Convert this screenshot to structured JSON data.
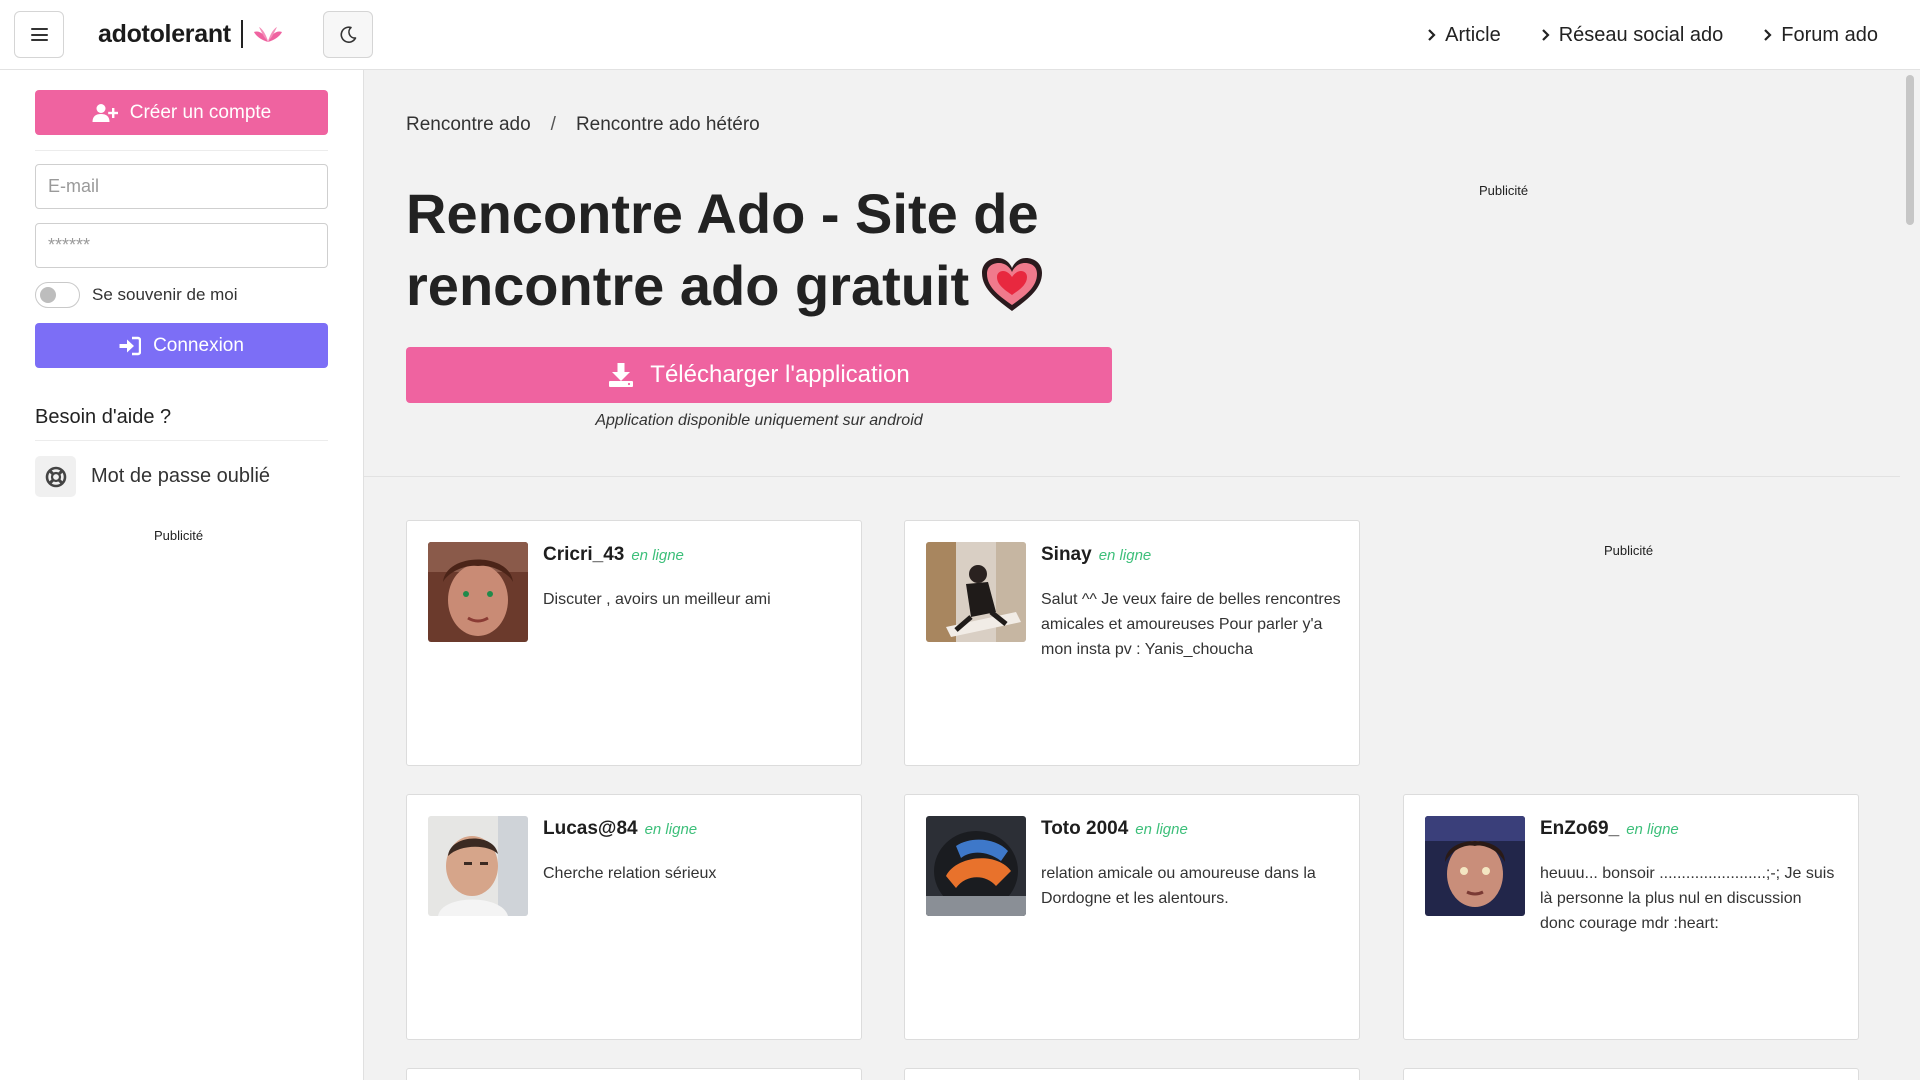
{
  "navbar": {
    "brand_text": "adotolerant",
    "links": [
      "Article",
      "Réseau social ado",
      "Forum ado"
    ]
  },
  "sidebar": {
    "create_account_label": "Créer un compte",
    "email_placeholder": "E-mail",
    "password_placeholder": "******",
    "remember_label": "Se souvenir de moi",
    "login_label": "Connexion",
    "help_title": "Besoin d'aide ?",
    "forgot_password_label": "Mot de passe oublié",
    "ad_label": "Publicité"
  },
  "main": {
    "breadcrumb": [
      "Rencontre ado",
      "Rencontre ado hétéro"
    ],
    "title": "Rencontre Ado - Site de rencontre ado gratuit",
    "download_label": "Télécharger l'application",
    "download_note": "Application disponible uniquement sur android",
    "ad_label": "Publicité"
  },
  "profiles": [
    {
      "name": "Cricri_43",
      "status": "en ligne",
      "bio": "Discuter , avoirs un meilleur ami"
    },
    {
      "name": "Sinay",
      "status": "en ligne",
      "bio": "Salut ^^ Je veux faire de belles rencontres amicales et amoureuses Pour parler y'a mon insta pv : Yanis_choucha"
    },
    {
      "name": "Lucas@84",
      "status": "en ligne",
      "bio": "Cherche relation sérieux"
    },
    {
      "name": "Toto 2004",
      "status": "en ligne",
      "bio": "relation amicale ou amoureuse dans la Dordogne et les alentours."
    },
    {
      "name": "EnZo69_",
      "status": "en ligne",
      "bio": "heuuu... bonsoir ........................;-; Je suis là personne la plus nul en discussion donc courage mdr :heart:"
    }
  ],
  "colors": {
    "pink_accent": "#ef63a0",
    "purple_accent": "#7c6ef6",
    "online_green": "#3dbf7a"
  },
  "icons": [
    "menu-icon",
    "moon-icon",
    "chevron-right-icon",
    "user-plus-icon",
    "sign-in-icon",
    "lifebuoy-icon",
    "download-icon",
    "heart-icon"
  ]
}
